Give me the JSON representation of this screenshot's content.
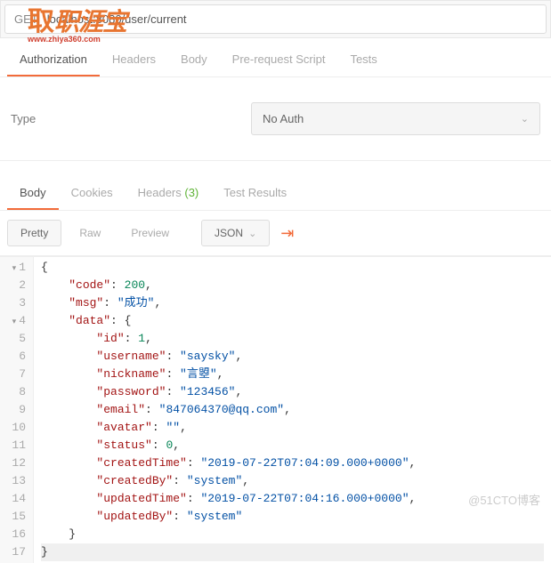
{
  "logo": {
    "main": "职涯宝",
    "sub": "www.zhiya360.com"
  },
  "request": {
    "method": "GET",
    "url": "localhost:8080/user/current"
  },
  "tabs1": {
    "items": [
      "Authorization",
      "Headers",
      "Body",
      "Pre-request Script",
      "Tests"
    ],
    "active": 0
  },
  "auth": {
    "typeLabel": "Type",
    "selected": "No Auth"
  },
  "tabs2": {
    "body": "Body",
    "cookies": "Cookies",
    "headers": "Headers",
    "headersCount": "(3)",
    "testResults": "Test Results",
    "active": 0
  },
  "toolbar": {
    "pretty": "Pretty",
    "raw": "Raw",
    "preview": "Preview",
    "format": "JSON"
  },
  "code": {
    "lines": [
      {
        "n": 1,
        "t": "brace",
        "txt": "{"
      },
      {
        "n": 2,
        "t": "kv",
        "k": "code",
        "v": 200,
        "vt": "num",
        "c": true,
        "i": 1
      },
      {
        "n": 3,
        "t": "kv",
        "k": "msg",
        "v": "成功",
        "vt": "str",
        "c": true,
        "i": 1
      },
      {
        "n": 4,
        "t": "open",
        "k": "data",
        "i": 1
      },
      {
        "n": 5,
        "t": "kv",
        "k": "id",
        "v": 1,
        "vt": "num",
        "c": true,
        "i": 2
      },
      {
        "n": 6,
        "t": "kv",
        "k": "username",
        "v": "saysky",
        "vt": "str",
        "c": true,
        "i": 2
      },
      {
        "n": 7,
        "t": "kv",
        "k": "nickname",
        "v": "言曌",
        "vt": "str",
        "c": true,
        "i": 2
      },
      {
        "n": 8,
        "t": "kv",
        "k": "password",
        "v": "123456",
        "vt": "str",
        "c": true,
        "i": 2
      },
      {
        "n": 9,
        "t": "kv",
        "k": "email",
        "v": "847064370@qq.com",
        "vt": "str",
        "c": true,
        "i": 2
      },
      {
        "n": 10,
        "t": "kv",
        "k": "avatar",
        "v": "",
        "vt": "str",
        "c": true,
        "i": 2
      },
      {
        "n": 11,
        "t": "kv",
        "k": "status",
        "v": 0,
        "vt": "num",
        "c": true,
        "i": 2
      },
      {
        "n": 12,
        "t": "kv",
        "k": "createdTime",
        "v": "2019-07-22T07:04:09.000+0000",
        "vt": "str",
        "c": true,
        "i": 2
      },
      {
        "n": 13,
        "t": "kv",
        "k": "createdBy",
        "v": "system",
        "vt": "str",
        "c": true,
        "i": 2
      },
      {
        "n": 14,
        "t": "kv",
        "k": "updatedTime",
        "v": "2019-07-22T07:04:16.000+0000",
        "vt": "str",
        "c": true,
        "i": 2
      },
      {
        "n": 15,
        "t": "kv",
        "k": "updatedBy",
        "v": "system",
        "vt": "str",
        "c": false,
        "i": 2
      },
      {
        "n": 16,
        "t": "close",
        "txt": "}",
        "i": 1
      },
      {
        "n": 17,
        "t": "close",
        "txt": "}",
        "i": 0,
        "hl": true
      }
    ]
  },
  "watermark": "@51CTO博客"
}
